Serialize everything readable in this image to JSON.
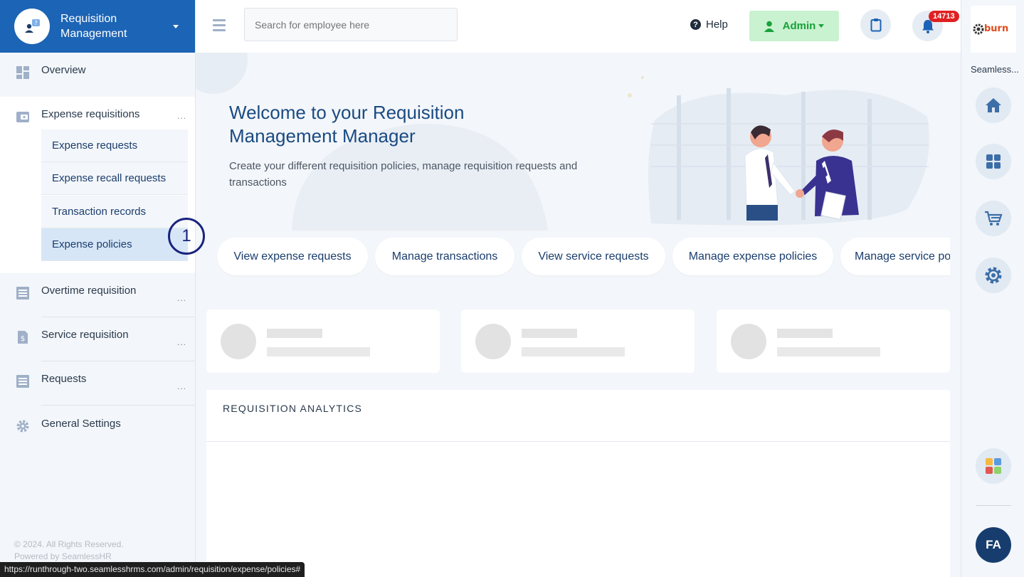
{
  "brand": {
    "title": "Requisition Management"
  },
  "sidebar": {
    "overview": "Overview",
    "expense_requisitions": "Expense requisitions",
    "expense_sub": [
      "Expense requests",
      "Expense recall requests",
      "Transaction records",
      "Expense policies"
    ],
    "overtime": "Overtime requisition",
    "service": "Service requisition",
    "requests": "Requests",
    "general_settings": "General Settings",
    "dots": "...",
    "footer_rights": "© 2024. All Rights Reserved.",
    "footer_powered": "Powered by SeamlessHR"
  },
  "annotation": "1",
  "status_url": "https://runthrough-two.seamlesshrms.com/admin/requisition/expense/policies#",
  "header": {
    "search_placeholder": "Search for employee here",
    "help": "Help",
    "admin": "Admin",
    "notifications": "14713"
  },
  "hero": {
    "title": "Welcome to your Requisition Management Manager",
    "subtitle": "Create your different requisition policies, manage requisition requests and transactions"
  },
  "quick_actions": [
    "View expense requests",
    "Manage transactions",
    "View service requests",
    "Manage expense policies",
    "Manage service policies"
  ],
  "analytics": {
    "title": "REQUISITION ANALYTICS"
  },
  "rail": {
    "company_name": "Seamless...",
    "logo_text": "burn",
    "avatar": "FA"
  },
  "colors": {
    "brand_blue": "#1c64b5",
    "admin_green": "#18a13a",
    "badge_red": "#e02020",
    "heading_blue": "#1a4b82"
  }
}
